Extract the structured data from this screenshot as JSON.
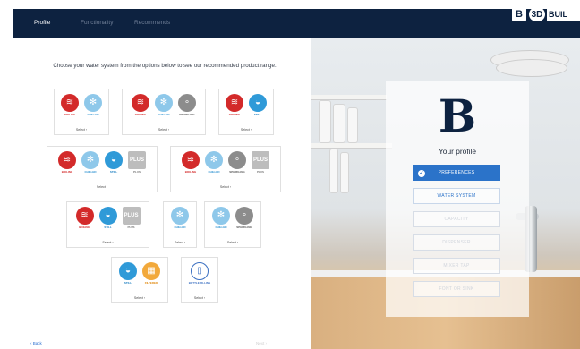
{
  "header": {
    "tabs": [
      {
        "label": "Profile",
        "active": true
      },
      {
        "label": "Functionality",
        "active": false
      },
      {
        "label": "Recommends",
        "active": false
      }
    ],
    "logo": {
      "b": "B",
      "three_d": "3D",
      "text": "BUIL"
    }
  },
  "main": {
    "headline": "Choose your water system from the options below to see our recommended product range.",
    "select_label": "Select",
    "cards": [
      {
        "icons": [
          {
            "name": "boiling-icon",
            "label": "BOILING"
          },
          {
            "name": "chilled-icon",
            "label": "CHILLED"
          }
        ]
      },
      {
        "icons": [
          {
            "name": "boiling-icon",
            "label": "BOILING"
          },
          {
            "name": "chilled-icon",
            "label": "CHILLED"
          },
          {
            "name": "sparkling-icon",
            "label": "SPARKLING"
          }
        ]
      },
      {
        "icons": [
          {
            "name": "boiling-icon",
            "label": "BOILING"
          },
          {
            "name": "still-icon",
            "label": "STILL"
          }
        ]
      },
      {
        "icons": [
          {
            "name": "boiling-icon",
            "label": "BOILING"
          },
          {
            "name": "chilled-icon",
            "label": "CHILLED"
          },
          {
            "name": "still-icon",
            "label": "STILL"
          },
          {
            "name": "plus-icon",
            "label": "PLUS"
          }
        ]
      },
      {
        "icons": [
          {
            "name": "boiling-icon",
            "label": "BOILING"
          },
          {
            "name": "chilled-icon",
            "label": "CHILLED"
          },
          {
            "name": "sparkling-icon",
            "label": "SPARKLING"
          },
          {
            "name": "plus-icon",
            "label": "PLUS"
          }
        ]
      },
      {
        "icons": [
          {
            "name": "boiling-icon",
            "label": "BOILING"
          },
          {
            "name": "still-icon",
            "label": "STILL"
          },
          {
            "name": "plus-icon",
            "label": "PLUS"
          }
        ]
      },
      {
        "icons": [
          {
            "name": "chilled-icon",
            "label": "CHILLED"
          }
        ]
      },
      {
        "icons": [
          {
            "name": "chilled-icon",
            "label": "CHILLED"
          },
          {
            "name": "sparkling-icon",
            "label": "SPARKLING"
          }
        ]
      },
      {
        "icons": [
          {
            "name": "still-icon",
            "label": "STILL"
          },
          {
            "name": "filtered-icon",
            "label": "FILTERED"
          }
        ]
      },
      {
        "icons": [
          {
            "name": "bottle-icon",
            "label": "BOTTLE FILLING"
          }
        ]
      }
    ],
    "back_label": "Back",
    "next_label": "Next"
  },
  "profile": {
    "logo_letter": "B",
    "title": "Your profile",
    "steps": [
      {
        "label": "PREFERENCES",
        "state": "done"
      },
      {
        "label": "WATER SYSTEM",
        "state": "next"
      },
      {
        "label": "CAPACITY",
        "state": "inactive"
      },
      {
        "label": "DISPENSER",
        "state": "inactive"
      },
      {
        "label": "MIXER TAP",
        "state": "inactive"
      },
      {
        "label": "FONT OR SINK",
        "state": "inactive"
      }
    ]
  },
  "colors": {
    "header_bg": "#0d2240",
    "accent": "#2b73c9",
    "boiling": "#d32a2a",
    "chilled": "#8ec8ea",
    "still": "#2f9ad8",
    "sparkling": "#8c8c8c",
    "filtered": "#f2a93b"
  }
}
